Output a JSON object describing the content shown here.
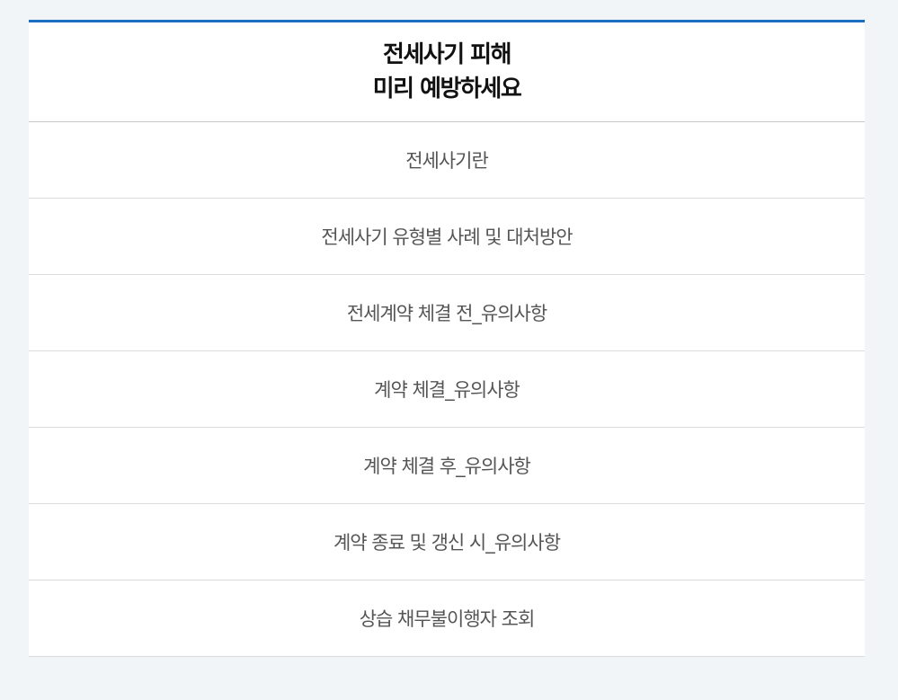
{
  "header": {
    "title_line1": "전세사기 피해",
    "title_line2": "미리 예방하세요"
  },
  "menu": {
    "items": [
      {
        "label": "전세사기란"
      },
      {
        "label": "전세사기 유형별 사례 및 대처방안"
      },
      {
        "label": "전세계약 체결 전_유의사항"
      },
      {
        "label": "계약 체결_유의사항"
      },
      {
        "label": "계약 체결 후_유의사항"
      },
      {
        "label": "계약 종료 및 갱신 시_유의사항"
      },
      {
        "label": "상습 채무불이행자 조회"
      }
    ]
  },
  "colors": {
    "accent": "#1a6fc0",
    "background": "#f2f5f8",
    "item_text": "#555555",
    "title_text": "#111111"
  }
}
